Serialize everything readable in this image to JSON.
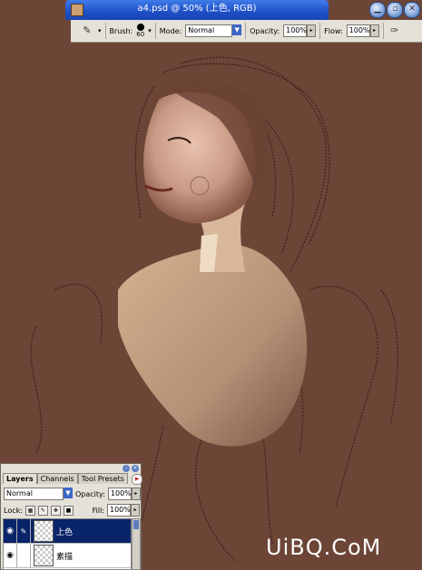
{
  "window": {
    "title": "a4.psd @ 50% (上色, RGB)"
  },
  "options_bar": {
    "brush_label": "Brush:",
    "brush_size": "60",
    "mode_label": "Mode:",
    "mode_value": "Normal",
    "opacity_label": "Opacity:",
    "opacity_value": "100%",
    "flow_label": "Flow:",
    "flow_value": "100%"
  },
  "layers_panel": {
    "tabs": [
      "Layers",
      "Channels",
      "Tool Presets"
    ],
    "blend_mode": "Normal",
    "opacity_label": "Opacity:",
    "opacity_value": "100%",
    "lock_label": "Lock:",
    "fill_label": "Fill:",
    "fill_value": "100%",
    "layers": [
      {
        "name": "上色",
        "selected": true
      },
      {
        "name": "素描",
        "selected": false
      }
    ]
  },
  "watermark": "UiBQ.CoM",
  "colors": {
    "canvas": "#6c4536",
    "selection": "#0a246a",
    "titlebar": "#1e4fc6"
  }
}
